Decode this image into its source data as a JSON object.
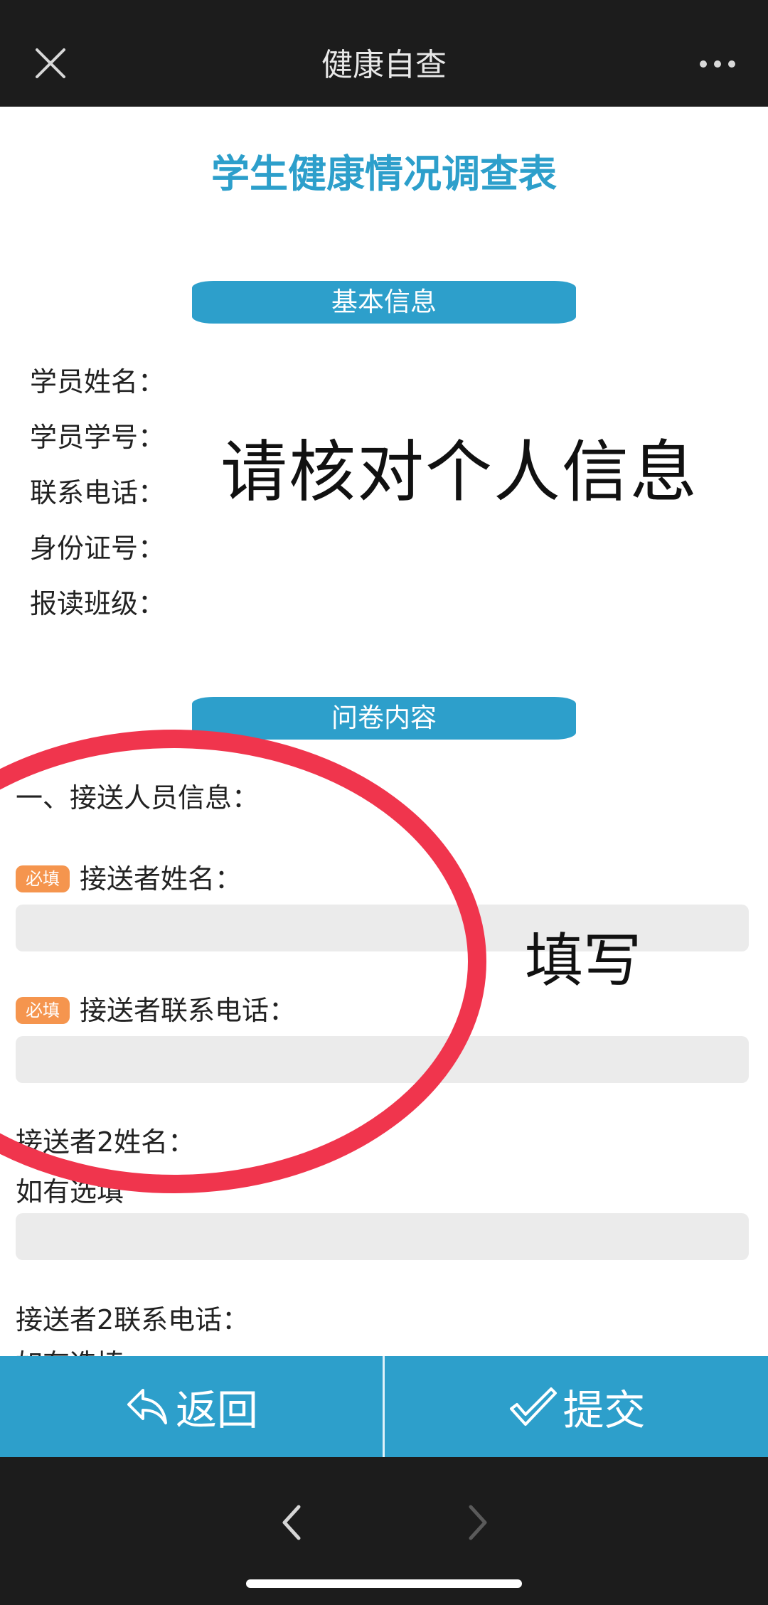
{
  "topbar": {
    "title": "健康自查",
    "close_icon": "close-icon",
    "more_icon": "more-icon"
  },
  "form": {
    "title": "学生健康情况调查表",
    "basic_section": "基本信息",
    "basic_fields": [
      "学员姓名：",
      "学员学号：",
      "联系电话：",
      "身份证号：",
      "报读班级："
    ],
    "overlay_verify": "请核对个人信息",
    "questionnaire_section": "问卷内容",
    "q1_heading": "一、接送人员信息：",
    "required_badge": "必填",
    "pickup_name_label": "接送者姓名：",
    "pickup_phone_label": "接送者联系电话：",
    "pickup2_name_label": "接送者2姓名：",
    "optional_hint": "如有选填",
    "pickup2_phone_label": "接送者2联系电话：",
    "overlay_fill": "填写",
    "annotation_color": "#f0354d"
  },
  "actions": {
    "back_label": "返回",
    "submit_label": "提交"
  },
  "browser_nav": {
    "back_icon": "chevron-left-icon",
    "forward_icon": "chevron-right-icon"
  },
  "colors": {
    "accent": "#2d9fcb",
    "badge": "#f5954e",
    "input_bg": "#ebebeb",
    "chrome": "#1c1c1c"
  }
}
